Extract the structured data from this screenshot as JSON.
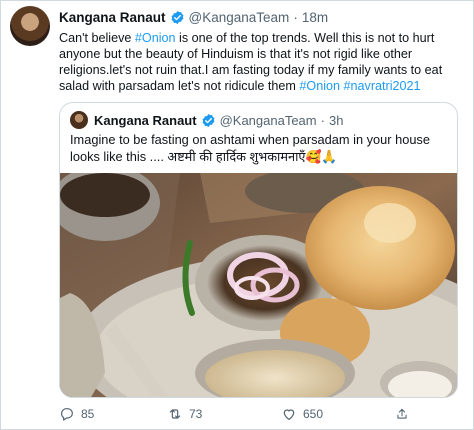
{
  "tweet": {
    "author_name": "Kangana Ranaut",
    "handle": "@KanganaTeam",
    "separator": "·",
    "time": "18m",
    "text_parts": [
      {
        "text": "Can't believe ",
        "link": false
      },
      {
        "text": "#Onion",
        "link": true
      },
      {
        "text": " is one of the top trends. Well this is not to hurt anyone but the beauty of Hinduism is that it's not rigid like other religions.let's not ruin that.I am fasting today if my family wants to eat salad with parsadam let's not ridicule them ",
        "link": false
      },
      {
        "text": "#Onion",
        "link": true
      },
      {
        "text": " ",
        "link": false
      },
      {
        "text": "#navratri2021",
        "link": true
      }
    ]
  },
  "quote": {
    "author_name": "Kangana Ranaut",
    "handle": "@KanganaTeam",
    "separator": "·",
    "time": "3h",
    "text": "Imagine to be fasting on ashtami when parsadam in your house looks like this .... अष्टमी की हार्दिक शुभकामनाएँ🥰🙏"
  },
  "actions": {
    "reply_count": "85",
    "retweet_count": "73",
    "like_count": "650"
  },
  "colors": {
    "link": "#1d9bf0",
    "verified": "#1d9bf0",
    "secondary_text": "#536471",
    "border": "#cfd9de"
  },
  "icons": [
    "verified-badge-icon",
    "reply-icon",
    "retweet-icon",
    "like-icon",
    "share-icon"
  ]
}
